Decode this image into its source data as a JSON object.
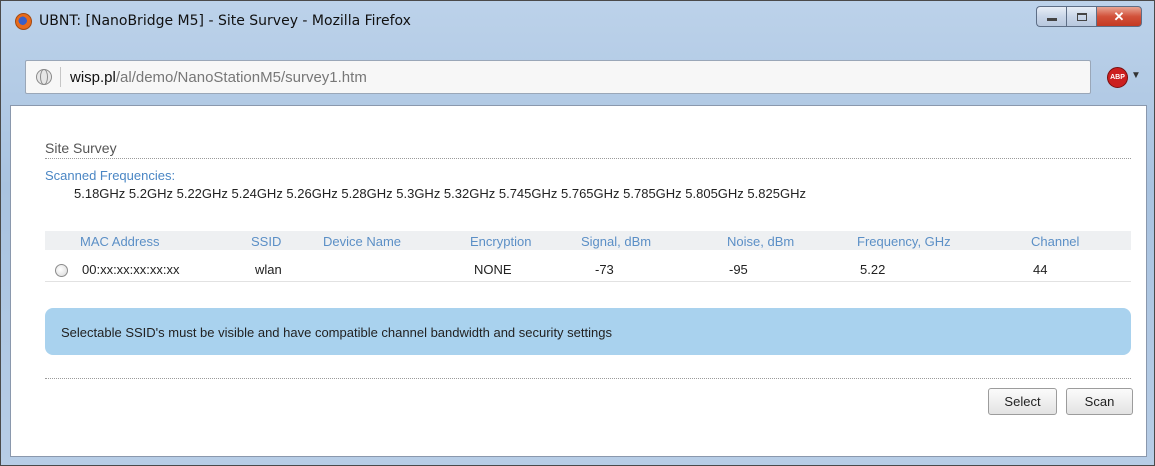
{
  "window": {
    "title": "UBNT: [NanoBridge M5] - Site Survey - Mozilla Firefox"
  },
  "urlbar": {
    "domain": "wisp.pl",
    "path": "/al/demo/NanoStationM5/survey1.htm"
  },
  "addon": {
    "label": "ABP"
  },
  "page": {
    "title": "Site Survey",
    "scanned_label": "Scanned Frequencies:",
    "scanned_values": "5.18GHz 5.2GHz 5.22GHz 5.24GHz 5.26GHz 5.28GHz 5.3GHz 5.32GHz 5.745GHz 5.765GHz 5.785GHz 5.805GHz 5.825GHz",
    "columns": {
      "mac": "MAC Address",
      "ssid": "SSID",
      "device": "Device Name",
      "encryption": "Encryption",
      "signal": "Signal, dBm",
      "noise": "Noise, dBm",
      "frequency": "Frequency, GHz",
      "channel": "Channel"
    },
    "rows": [
      {
        "mac": "00:xx:xx:xx:xx:xx",
        "ssid": "wlan",
        "device": "",
        "encryption": "NONE",
        "signal": "-73",
        "noise": "-95",
        "frequency": "5.22",
        "channel": "44"
      }
    ],
    "info": "Selectable SSID's must be visible and have compatible channel bandwidth and security settings",
    "buttons": {
      "select": "Select",
      "scan": "Scan"
    }
  },
  "colors": {
    "header_text": "#5b8fc6",
    "info_background": "#a9d2ee"
  }
}
